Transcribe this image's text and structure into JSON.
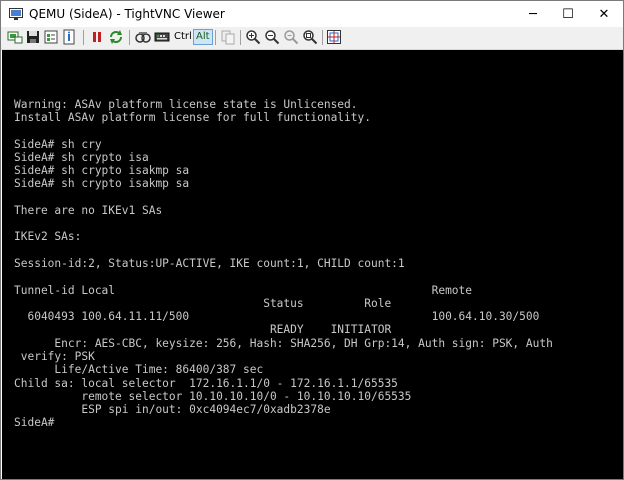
{
  "window": {
    "title": "QEMU (SideA) - TightVNC Viewer",
    "controls": {
      "minimize": "─",
      "maximize": "☐",
      "close": "✕"
    }
  },
  "toolbar": {
    "buttons": [
      {
        "name": "new-connection-icon"
      },
      {
        "name": "save-icon"
      },
      {
        "name": "options-icon"
      },
      {
        "name": "connection-info-icon"
      },
      {
        "name": "pause-icon"
      },
      {
        "name": "refresh-icon"
      },
      {
        "name": "transfer-icon"
      },
      {
        "name": "send-ctrl-alt-del-icon"
      }
    ],
    "ctrl_label": "Ctrl",
    "alt_label": "Alt",
    "zoom_buttons": [
      {
        "name": "zoom-in-icon"
      },
      {
        "name": "zoom-out-icon"
      },
      {
        "name": "zoom-100-icon"
      },
      {
        "name": "zoom-auto-icon"
      },
      {
        "name": "fullscreen-icon"
      }
    ]
  },
  "terminal": {
    "lines": [
      "Warning: ASAv platform license state is Unlicensed.",
      "Install ASAv platform license for full functionality.",
      "",
      "SideA# sh cry",
      "SideA# sh crypto isa",
      "SideA# sh crypto isakmp sa",
      "SideA# sh crypto isakmp sa",
      "",
      "There are no IKEv1 SAs",
      "",
      "IKEv2 SAs:",
      "",
      "Session-id:2, Status:UP-ACTIVE, IKE count:1, CHILD count:1",
      "",
      "Tunnel-id Local                                               Remote",
      "                                     Status         Role",
      "  6040493 100.64.11.11/500                                    100.64.10.30/500",
      "                                      READY    INITIATOR",
      "      Encr: AES-CBC, keysize: 256, Hash: SHA256, DH Grp:14, Auth sign: PSK, Auth",
      " verify: PSK",
      "      Life/Active Time: 86400/387 sec",
      "Child sa: local selector  172.16.1.1/0 - 172.16.1.1/65535",
      "          remote selector 10.10.10.10/0 - 10.10.10.10/65535",
      "          ESP spi in/out: 0xc4094ec7/0xadb2378e",
      "SideA#"
    ]
  }
}
